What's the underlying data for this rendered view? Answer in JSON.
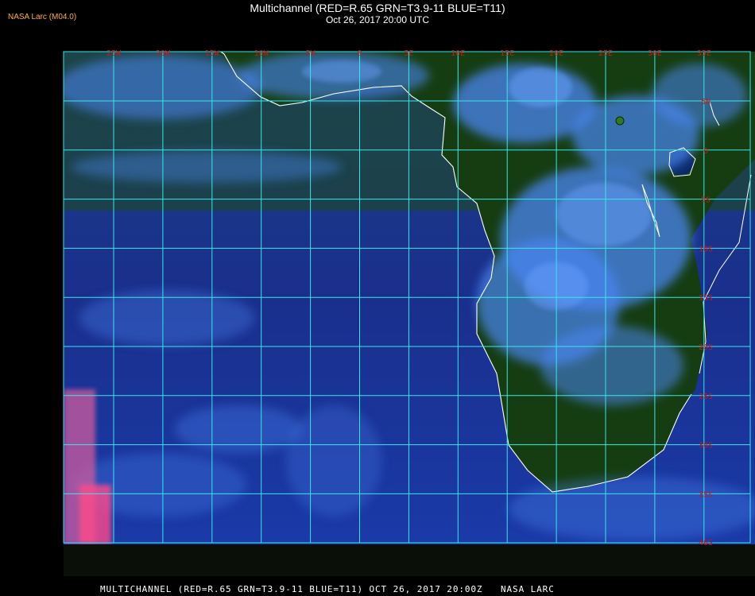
{
  "header": {
    "logo": "NASA Larc (M04.0)",
    "title": "Multichannel (RED=R.65 GRN=T3.9-11 BLUE=T11)",
    "subtitle": "Oct 26, 2017 20:00 UTC"
  },
  "footer": {
    "caption": "MULTICHANNEL (RED=R.65 GRN=T3.9-11 BLUE=T11) OCT 26, 2017 20:00Z   NASA LARC"
  },
  "map": {
    "longitude_labels": [
      "25W",
      "20W",
      "15W",
      "10W",
      "5W",
      "0",
      "5E",
      "10E",
      "15E",
      "20E",
      "25E",
      "30E",
      "35E"
    ],
    "latitude_labels": [
      "5N",
      "0",
      "5S",
      "10S",
      "15S",
      "20S",
      "25S",
      "30S",
      "35S",
      "40S"
    ],
    "colors": {
      "land": "#163a14",
      "ocean": "#16329a",
      "cloud": "#3f7cf0",
      "grid": "#36e8e8",
      "coast": "#ffffff",
      "tick_label": "#c81818"
    }
  }
}
